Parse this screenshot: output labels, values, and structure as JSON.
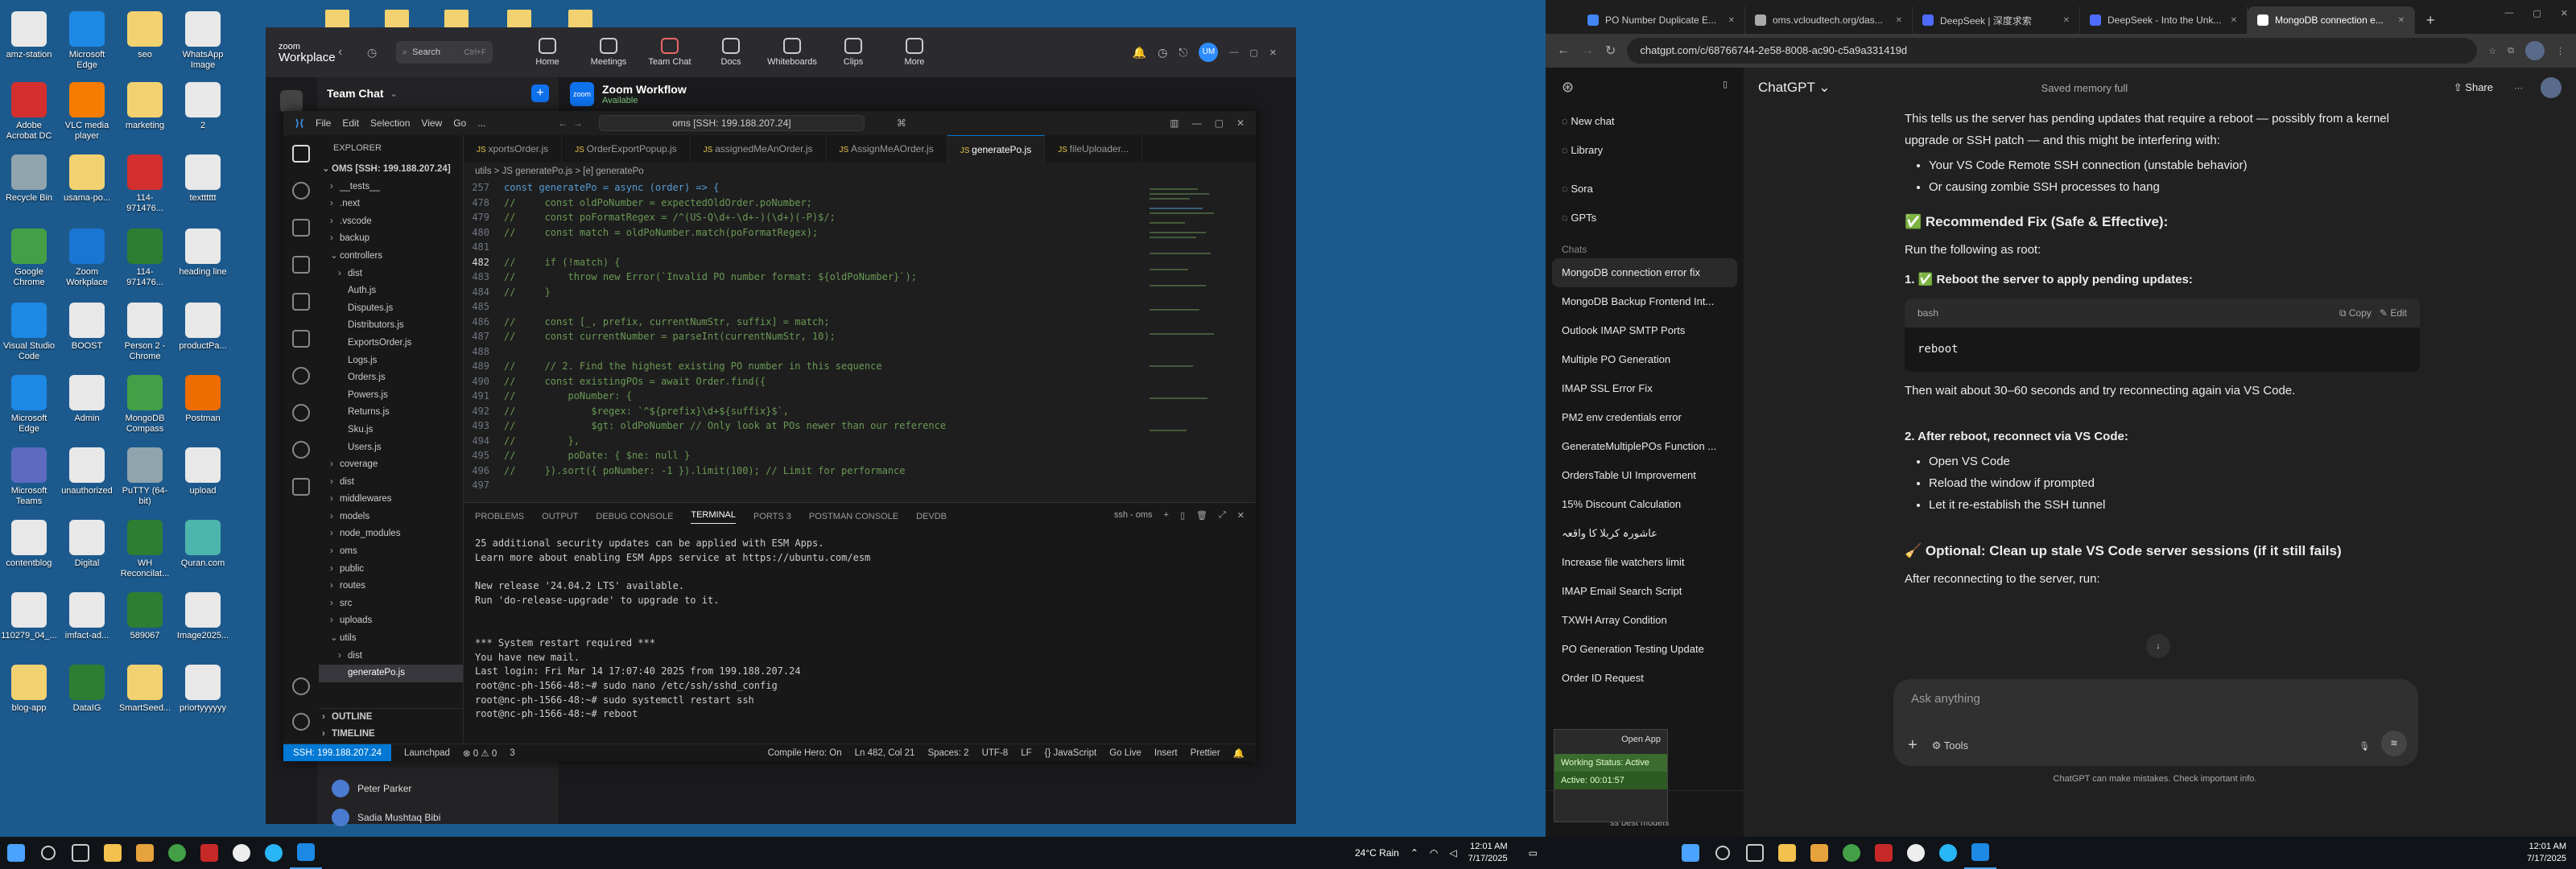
{
  "desktop": {
    "icons": [
      {
        "label": "amz-station",
        "color": "#e8e8e8"
      },
      {
        "label": "Microsoft Edge",
        "color": "#1e88e5"
      },
      {
        "label": "seo",
        "color": "#f2d270"
      },
      {
        "label": "WhatsApp Image 2025...",
        "color": "#e8e8e8"
      },
      {
        "label": "Adobe Acrobat DC",
        "color": "#d32f2f"
      },
      {
        "label": "VLC media player",
        "color": "#f57c00"
      },
      {
        "label": "marketing",
        "color": "#f2d270"
      },
      {
        "label": "2",
        "color": "#e8e8e8"
      },
      {
        "label": "Recycle Bin",
        "color": "#90a4ae"
      },
      {
        "label": "usama-po...",
        "color": "#f2d270"
      },
      {
        "label": "114-971476...",
        "color": "#d32f2f"
      },
      {
        "label": "textttttt",
        "color": "#e8e8e8"
      },
      {
        "label": "Google Chrome",
        "color": "#43a047"
      },
      {
        "label": "Zoom Workplace",
        "color": "#1976d2"
      },
      {
        "label": "114-971476...",
        "color": "#2e7d32"
      },
      {
        "label": "heading line",
        "color": "#e8e8e8"
      },
      {
        "label": "Visual Studio Code",
        "color": "#1e88e5"
      },
      {
        "label": "BOOST",
        "color": "#e8e8e8"
      },
      {
        "label": "Person 2 - Chrome",
        "color": "#e8e8e8"
      },
      {
        "label": "productPa...",
        "color": "#e8e8e8"
      },
      {
        "label": "Microsoft Edge",
        "color": "#1e88e5"
      },
      {
        "label": "Admin",
        "color": "#e8e8e8"
      },
      {
        "label": "MongoDB Compass",
        "color": "#43a047"
      },
      {
        "label": "Postman",
        "color": "#ef6c00"
      },
      {
        "label": "Microsoft Teams",
        "color": "#5c6bc0"
      },
      {
        "label": "unauthorized",
        "color": "#e8e8e8"
      },
      {
        "label": "PuTTY (64-bit)",
        "color": "#90a4ae"
      },
      {
        "label": "upload",
        "color": "#e8e8e8"
      },
      {
        "label": "contentblog",
        "color": "#e8e8e8"
      },
      {
        "label": "Digital",
        "color": "#e8e8e8"
      },
      {
        "label": "WH Reconcilat...",
        "color": "#2e7d32"
      },
      {
        "label": "Quran.com",
        "color": "#4db6ac"
      },
      {
        "label": "110279_04_...",
        "color": "#e8e8e8"
      },
      {
        "label": "imfact-ad...",
        "color": "#e8e8e8"
      },
      {
        "label": "589067",
        "color": "#2e7d32"
      },
      {
        "label": "Image2025...",
        "color": "#e8e8e8"
      },
      {
        "label": "blog-app",
        "color": "#f2d270"
      },
      {
        "label": "DataIG",
        "color": "#2e7d32"
      },
      {
        "label": "SmartSeed...",
        "color": "#f2d270"
      },
      {
        "label": "priortyyyyyy",
        "color": "#e8e8e8"
      }
    ]
  },
  "zoom": {
    "brand": "zoom",
    "brand2": "Workplace",
    "search": "Search",
    "search_shortcut": "Ctrl+F",
    "tabs": [
      {
        "label": "Home"
      },
      {
        "label": "Meetings"
      },
      {
        "label": "Team Chat",
        "badge": "1"
      },
      {
        "label": "Docs"
      },
      {
        "label": "Whiteboards"
      },
      {
        "label": "Clips"
      },
      {
        "label": "More",
        "badge": "NEW"
      }
    ],
    "avatar": "UM",
    "team_chat_title": "Team Chat",
    "workflow_title": "Zoom Workflow",
    "workflow_status": "Available",
    "contacts": [
      {
        "name": "Peter Parker"
      },
      {
        "name": "Sadia Mushtaq Bibi"
      }
    ]
  },
  "vscode": {
    "menu": [
      "File",
      "Edit",
      "Selection",
      "View",
      "Go",
      "..."
    ],
    "search": "oms [SSH: 199.188.207.24]",
    "explorer_title": "EXPLORER",
    "root": "OMS [SSH: 199.188.207.24]",
    "tree": [
      {
        "label": "__tests__",
        "type": "dir",
        "depth": 1
      },
      {
        "label": ".next",
        "type": "dir",
        "depth": 1
      },
      {
        "label": ".vscode",
        "type": "dir",
        "depth": 1
      },
      {
        "label": "backup",
        "type": "dir",
        "depth": 1
      },
      {
        "label": "controllers",
        "type": "open",
        "depth": 1
      },
      {
        "label": "dist",
        "type": "dir",
        "depth": 2
      },
      {
        "label": "Auth.js",
        "type": "file",
        "depth": 2
      },
      {
        "label": "Disputes.js",
        "type": "file",
        "depth": 2
      },
      {
        "label": "Distributors.js",
        "type": "file",
        "depth": 2
      },
      {
        "label": "ExportsOrder.js",
        "type": "file",
        "depth": 2
      },
      {
        "label": "Logs.js",
        "type": "file",
        "depth": 2
      },
      {
        "label": "Orders.js",
        "type": "file",
        "depth": 2
      },
      {
        "label": "Powers.js",
        "type": "file",
        "depth": 2
      },
      {
        "label": "Returns.js",
        "type": "file",
        "depth": 2
      },
      {
        "label": "Sku.js",
        "type": "file",
        "depth": 2
      },
      {
        "label": "Users.js",
        "type": "file",
        "depth": 2
      },
      {
        "label": "coverage",
        "type": "dir",
        "depth": 1
      },
      {
        "label": "dist",
        "type": "dir",
        "depth": 1
      },
      {
        "label": "middlewares",
        "type": "dir",
        "depth": 1
      },
      {
        "label": "models",
        "type": "dir",
        "depth": 1
      },
      {
        "label": "node_modules",
        "type": "dir",
        "depth": 1
      },
      {
        "label": "oms",
        "type": "dir",
        "depth": 1
      },
      {
        "label": "public",
        "type": "dir",
        "depth": 1
      },
      {
        "label": "routes",
        "type": "dir",
        "depth": 1
      },
      {
        "label": "src",
        "type": "dir",
        "depth": 1
      },
      {
        "label": "uploads",
        "type": "dir",
        "depth": 1
      },
      {
        "label": "utils",
        "type": "open",
        "depth": 1
      },
      {
        "label": "dist",
        "type": "dir",
        "depth": 2
      },
      {
        "label": "generatePo.js",
        "type": "file",
        "depth": 2,
        "selected": true
      }
    ],
    "outline": "OUTLINE",
    "timeline": "TIMELINE",
    "tabs": [
      {
        "label": "xportsOrder.js"
      },
      {
        "label": "OrderExportPopup.js"
      },
      {
        "label": "assignedMeAnOrder.js"
      },
      {
        "label": "AssignMeAOrder.js"
      },
      {
        "label": "generatePo.js",
        "active": true
      },
      {
        "label": "fileUploader..."
      }
    ],
    "breadcrumb": "utils > JS generatePo.js > [e] generatePo",
    "code": [
      {
        "n": "257",
        "t": "const generatePo = async (order) => {",
        "c": "kw"
      },
      {
        "n": "478",
        "t": "//     const oldPoNumber = expectedOldOrder.poNumber;",
        "c": "cm"
      },
      {
        "n": "479",
        "t": "//     const poFormatRegex = /^(US-Q\\d+-\\d+-)(\\d+)(-P)$/;",
        "c": "cm"
      },
      {
        "n": "480",
        "t": "//     const match = oldPoNumber.match(poFormatRegex);",
        "c": "cm"
      },
      {
        "n": "481",
        "t": "",
        "c": ""
      },
      {
        "n": "482",
        "t": "//     if (!match) {",
        "c": "cm",
        "cur": true
      },
      {
        "n": "483",
        "t": "//         throw new Error(`Invalid PO number format: ${oldPoNumber}`);",
        "c": "cm"
      },
      {
        "n": "484",
        "t": "//     }",
        "c": "cm"
      },
      {
        "n": "485",
        "t": "",
        "c": ""
      },
      {
        "n": "486",
        "t": "//     const [_, prefix, currentNumStr, suffix] = match;",
        "c": "cm"
      },
      {
        "n": "487",
        "t": "//     const currentNumber = parseInt(currentNumStr, 10);",
        "c": "cm"
      },
      {
        "n": "488",
        "t": "",
        "c": ""
      },
      {
        "n": "489",
        "t": "//     // 2. Find the highest existing PO number in this sequence",
        "c": "cm"
      },
      {
        "n": "490",
        "t": "//     const existingPOs = await Order.find({",
        "c": "cm"
      },
      {
        "n": "491",
        "t": "//         poNumber: {",
        "c": "cm"
      },
      {
        "n": "492",
        "t": "//             $regex: `^${prefix}\\d+${suffix}$`,",
        "c": "cm"
      },
      {
        "n": "493",
        "t": "//             $gt: oldPoNumber // Only look at POs newer than our reference",
        "c": "cm"
      },
      {
        "n": "494",
        "t": "//         },",
        "c": "cm"
      },
      {
        "n": "495",
        "t": "//         poDate: { $ne: null }",
        "c": "cm"
      },
      {
        "n": "496",
        "t": "//     }).sort({ poNumber: -1 }).limit(100); // Limit for performance",
        "c": "cm"
      },
      {
        "n": "497",
        "t": "",
        "c": ""
      }
    ],
    "panel_tabs": [
      "PROBLEMS",
      "OUTPUT",
      "DEBUG CONSOLE",
      "TERMINAL",
      "PORTS 3",
      "POSTMAN CONSOLE",
      "DEVDB"
    ],
    "terminal_name": "ssh - oms",
    "terminal": [
      "25 additional security updates can be applied with ESM Apps.",
      "Learn more about enabling ESM Apps service at https://ubuntu.com/esm",
      "",
      "New release '24.04.2 LTS' available.",
      "Run 'do-release-upgrade' to upgrade to it.",
      "",
      "",
      "*** System restart required ***",
      "You have new mail.",
      "Last login: Fri Mar 14 17:07:40 2025 from 199.188.207.24",
      "root@nc-ph-1566-48:~# sudo nano /etc/ssh/sshd_config",
      "root@nc-ph-1566-48:~# sudo systemctl restart ssh",
      "root@nc-ph-1566-48:~# reboot",
      ""
    ],
    "status": {
      "remote": "SSH: 199.188.207.24",
      "launchpad": "Launchpad",
      "problems": "⊗ 0 ⚠ 0",
      "ports": "3",
      "compile": "Compile Hero: On",
      "position": "Ln 482, Col 21",
      "spaces": "Spaces: 2",
      "encoding": "UTF-8",
      "eol": "LF",
      "lang": "{} JavaScript",
      "golive": "Go Live",
      "insert": "Insert",
      "prettier": "Prettier"
    }
  },
  "chrome": {
    "tabs": [
      {
        "label": "PO Number Duplicate E...",
        "color": "#4285f4"
      },
      {
        "label": "oms.vcloudtech.org/das...",
        "color": "#aaaaaa"
      },
      {
        "label": "DeepSeek | 深度求索",
        "color": "#4d6bfe"
      },
      {
        "label": "DeepSeek - Into the Unk...",
        "color": "#4d6bfe"
      },
      {
        "label": "MongoDB connection e...",
        "color": "#ffffff",
        "active": true
      }
    ],
    "url": "chatgpt.com/c/68766744-2e58-8008-ac90-c5a9a331419d"
  },
  "chatgpt": {
    "model": "ChatGPT",
    "memory": "Saved memory full",
    "share": "Share",
    "nav": [
      "New chat",
      "Library",
      "Sora",
      "GPTs"
    ],
    "chats_header": "Chats",
    "chats": [
      "MongoDB connection error fix",
      "MongoDB Backup Frontend Int...",
      "Outlook IMAP SMTP Ports",
      "Multiple PO Generation",
      "IMAP SSL Error Fix",
      "PM2 env credentials error",
      "GenerateMultiplePOs Function ...",
      "OrdersTable UI Improvement",
      "15% Discount Calculation",
      "عاشورہ کربلا کا واقعہ",
      "Increase file watchers limit",
      "IMAP Email Search Script",
      "TXWH Array Condition",
      "PO Generation Testing Update",
      "Order ID Request"
    ],
    "intro": "This tells us the server has pending updates that require a reboot — possibly from a kernel upgrade or SSH patch — and this might be interfering with:",
    "bullets1": [
      "Your VS Code Remote SSH connection (unstable behavior)",
      "Or causing zombie SSH processes to hang"
    ],
    "fix_heading": "✅ Recommended Fix (Safe & Effective):",
    "run_as": "Run the following as root:",
    "step1": "1. ✅ Reboot the server to apply pending updates:",
    "code_lang": "bash",
    "copy": "Copy",
    "edit": "Edit",
    "code": "reboot",
    "wait": "Then wait about 30–60 seconds and try reconnecting again via VS Code.",
    "step2": "2. After reboot, reconnect via VS Code:",
    "bullets2": [
      "Open VS Code",
      "Reload the window if prompted",
      "Let it re-establish the SSH tunnel"
    ],
    "optional": "🧹 Optional: Clean up stale VS Code server sessions (if it still fails)",
    "after": "After reconnecting to the server, run:",
    "placeholder": "Ask anything",
    "tools": "Tools",
    "disclaimer": "ChatGPT can make mistakes. Check important info.",
    "upgrade_hint": "ss best models"
  },
  "taskbar": {
    "weather": "24°C  Rain",
    "time": "12:01 AM",
    "date": "7/17/2025"
  },
  "popup": {
    "open_app": "Open App",
    "working": "Working Status: Active",
    "active": "Active: 00:01:57"
  }
}
